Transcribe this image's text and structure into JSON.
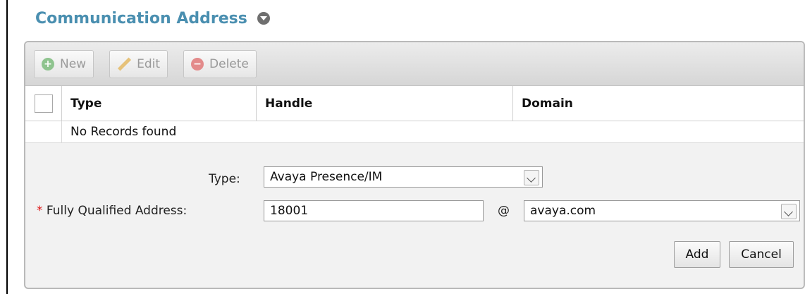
{
  "section": {
    "title": "Communication Address"
  },
  "toolbar": {
    "new_label": "New",
    "edit_label": "Edit",
    "delete_label": "Delete"
  },
  "table": {
    "columns": [
      "Type",
      "Handle",
      "Domain"
    ],
    "empty_message": "No Records found"
  },
  "form": {
    "type_label": "Type:",
    "type_value": "Avaya Presence/IM",
    "required_marker": "*",
    "address_label": "Fully Qualified Address:",
    "address_value": "18001",
    "at_symbol": "@",
    "domain_value": "avaya.com",
    "add_label": "Add",
    "cancel_label": "Cancel"
  }
}
